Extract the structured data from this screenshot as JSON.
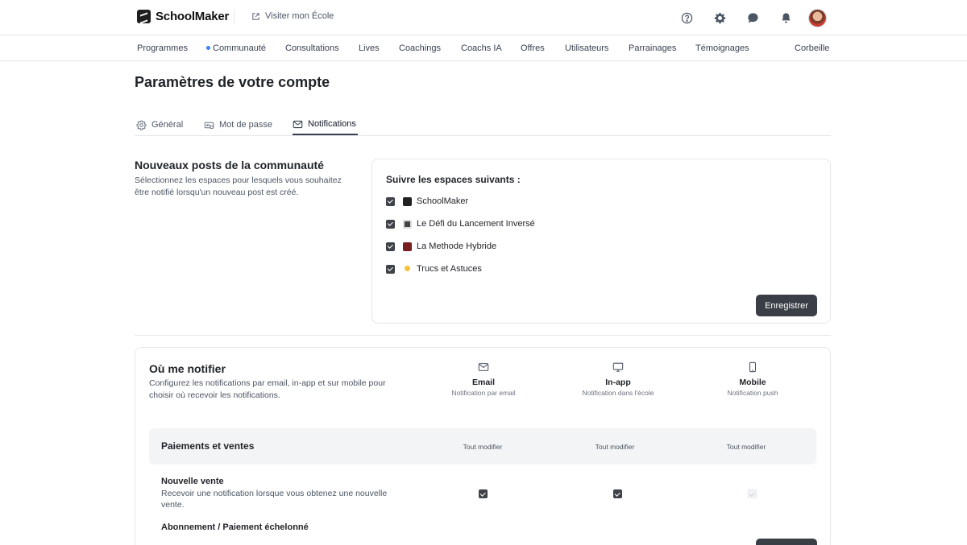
{
  "app": {
    "name": "SchoolMaker",
    "visit_label": "Visiter mon École"
  },
  "top_icons": [
    "help-icon",
    "gear-icon",
    "chat-icon",
    "bell-icon"
  ],
  "nav": {
    "items": [
      "Programmes",
      "Communauté",
      "Consultations",
      "Lives",
      "Coachings",
      "Coachs IA",
      "Offres",
      "Utilisateurs",
      "Parrainages",
      "Témoignages"
    ],
    "trash": "Corbeille"
  },
  "page": {
    "title": "Paramètres de votre compte"
  },
  "tabs": [
    {
      "label": "Général",
      "icon": "gear-icon"
    },
    {
      "label": "Mot de passe",
      "icon": "password-icon"
    },
    {
      "label": "Notifications",
      "icon": "mail-icon",
      "active": true
    }
  ],
  "community": {
    "title": "Nouveaux posts de la communauté",
    "description": "Sélectionnez les espaces pour lesquels vous souhaitez être notifié lorsqu'un nouveau post est créé.",
    "card_title": "Suivre les espaces suivants :",
    "spaces": [
      {
        "name": "SchoolMaker",
        "checked": true,
        "icon_color": "#222222"
      },
      {
        "name": "Le Défi du Lancement Inversé",
        "checked": true,
        "icon_color": "#333333"
      },
      {
        "name": "La Methode Hybride",
        "checked": true,
        "icon_color": "#7a1f1f"
      },
      {
        "name": "Trucs et Astuces",
        "checked": true,
        "icon_color": "#f5c542"
      }
    ],
    "save_label": "Enregistrer"
  },
  "where": {
    "title": "Où me notifier",
    "description": "Configurez les notifications par email, in-app et sur mobile pour choisir où recevoir les notifications.",
    "channels": [
      {
        "name": "Email",
        "sub": "Notification par email",
        "icon": "mail-icon"
      },
      {
        "name": "In-app",
        "sub": "Notification dans l'école",
        "icon": "monitor-icon"
      },
      {
        "name": "Mobile",
        "sub": "Notification push",
        "icon": "phone-icon"
      }
    ],
    "group": {
      "title": "Paiements et ventes",
      "modify_all": "Tout modifier"
    },
    "rows": [
      {
        "title": "Nouvelle vente",
        "desc": "Recevoir une notification lorsque vous obtenez une nouvelle vente.",
        "email": true,
        "inapp": true,
        "mobile": false,
        "mobile_disabled": true
      },
      {
        "title": "Abonnement / Paiement échelonné",
        "desc": ""
      }
    ]
  }
}
